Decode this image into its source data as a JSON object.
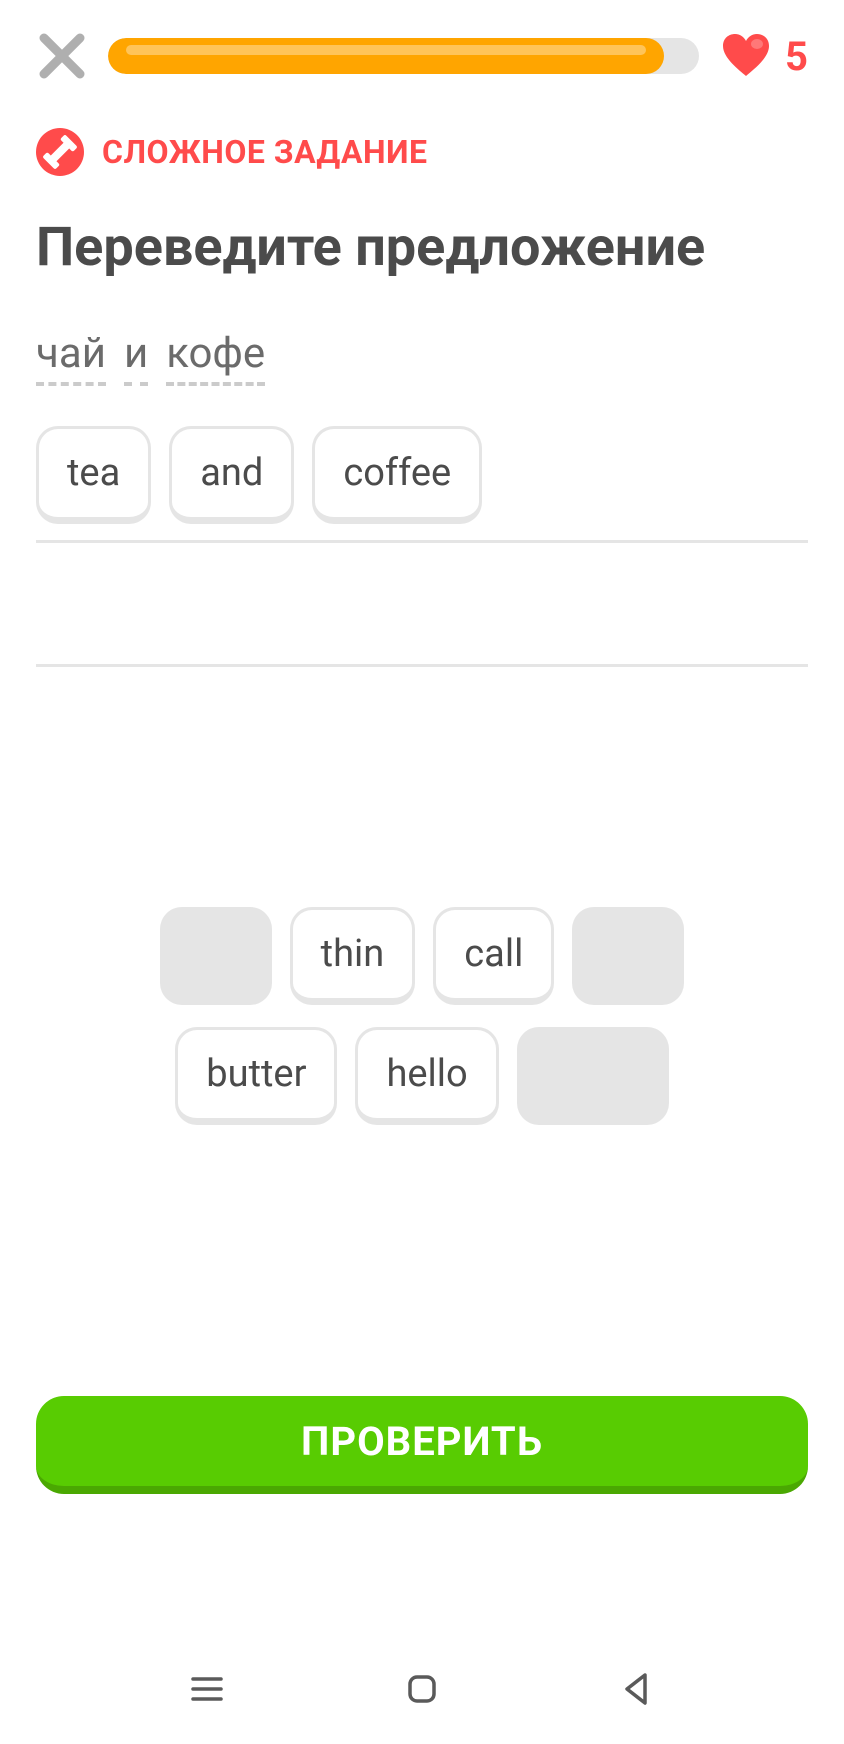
{
  "header": {
    "hearts": "5",
    "progress_percent": 94
  },
  "challenge": {
    "label": "СЛОЖНОЕ ЗАДАНИЕ"
  },
  "task": {
    "title": "Переведите предложение",
    "words": [
      "чай",
      "и",
      "кофе"
    ]
  },
  "answer": {
    "chips": [
      "tea",
      "and",
      "coffee"
    ]
  },
  "bank": {
    "row1": [
      {
        "type": "empty"
      },
      {
        "type": "word",
        "text": "thin"
      },
      {
        "type": "word",
        "text": "call"
      },
      {
        "type": "empty"
      }
    ],
    "row2": [
      {
        "type": "word",
        "text": "butter"
      },
      {
        "type": "word",
        "text": "hello"
      },
      {
        "type": "empty",
        "wide": true
      }
    ]
  },
  "check_button": "ПРОВЕРИТЬ"
}
